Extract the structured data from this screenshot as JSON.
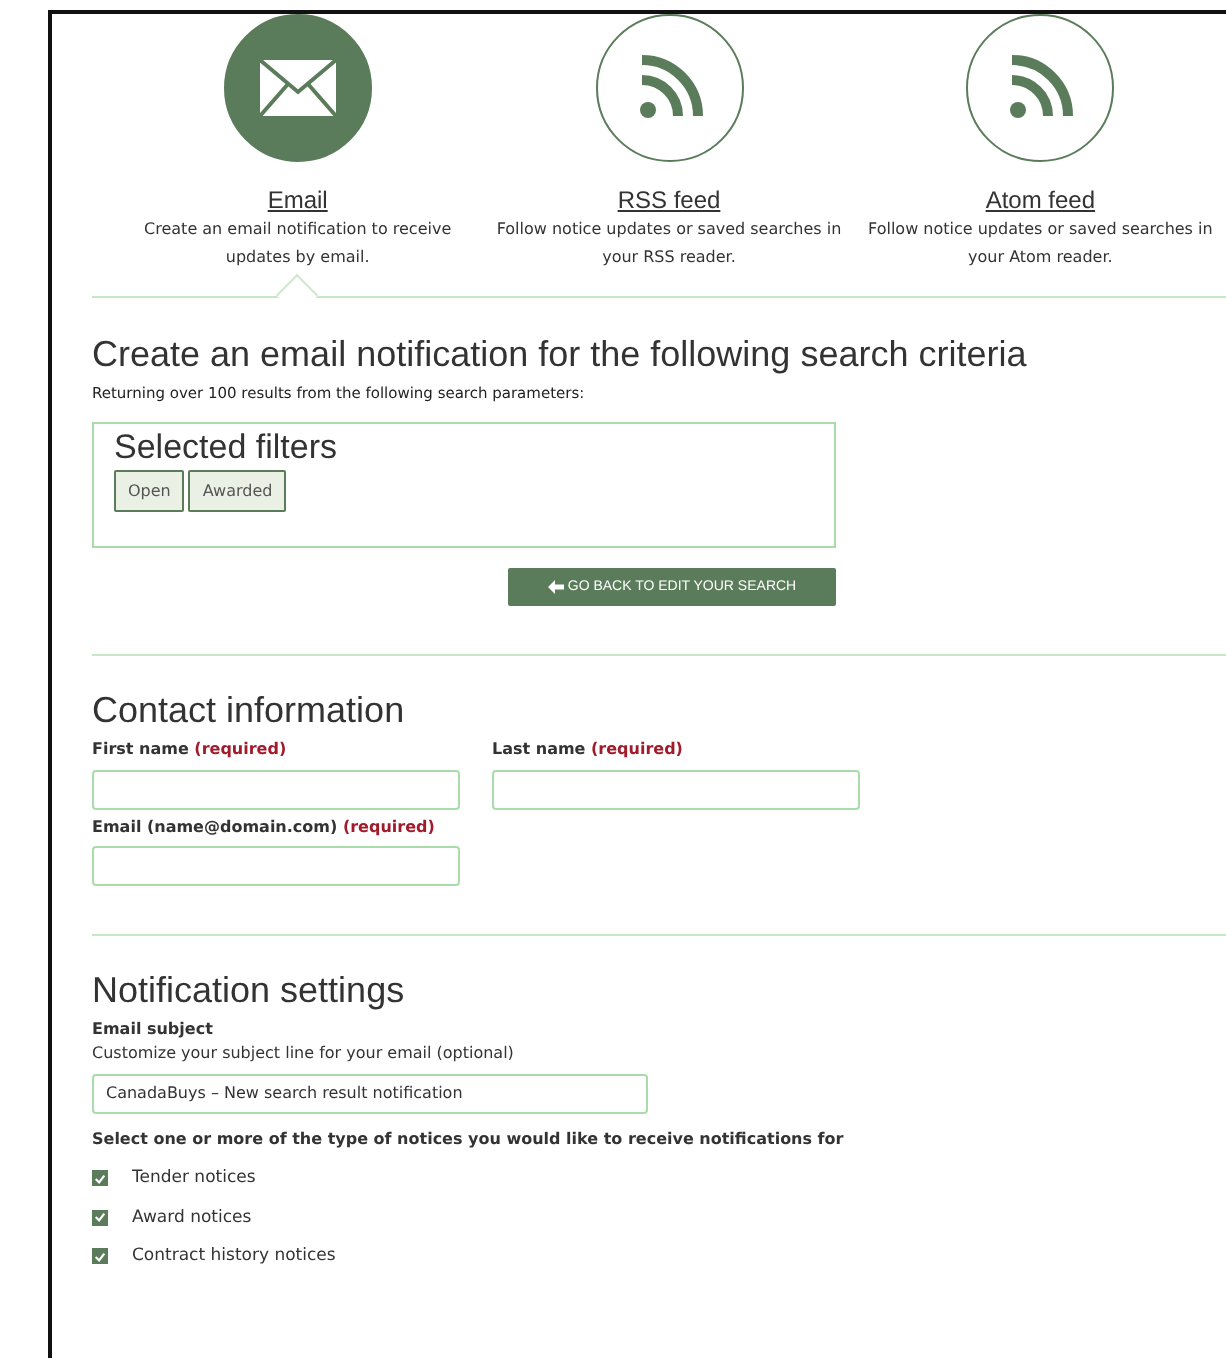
{
  "options": [
    {
      "kind": "email",
      "label": "Email",
      "description": "Create an email notification to receive updates by email.",
      "selected": true
    },
    {
      "kind": "feed",
      "label": "RSS feed",
      "description": "Follow notice updates or saved searches in your RSS reader.",
      "selected": false
    },
    {
      "kind": "feed",
      "label": "Atom feed",
      "description": "Follow notice updates or saved searches in your Atom reader.",
      "selected": false
    }
  ],
  "criteria": {
    "heading": "Create an email notification for the following search criteria",
    "summary": "Returning over 100 results from the following search parameters:",
    "filters_title": "Selected filters",
    "filters": [
      "Open",
      "Awarded"
    ],
    "back_button": "GO BACK TO EDIT YOUR SEARCH"
  },
  "contact": {
    "heading": "Contact information",
    "fields": [
      {
        "label": "First name",
        "required": "(required)"
      },
      {
        "label": "Last name",
        "required": "(required)"
      },
      {
        "label": "Email (name@domain.com)",
        "required": "(required)"
      }
    ]
  },
  "settings": {
    "heading": "Notification settings",
    "subject_label": "Email subject",
    "subject_hint": "Customize your subject line for your email (optional)",
    "subject_value": "CanadaBuys – New search result notification",
    "types_label": "Select one or more of the type of notices you would like to receive notifications for",
    "types": [
      {
        "label": "Tender notices",
        "checked": true
      },
      {
        "label": "Award notices",
        "checked": true
      },
      {
        "label": "Contract history notices",
        "checked": true
      }
    ]
  }
}
